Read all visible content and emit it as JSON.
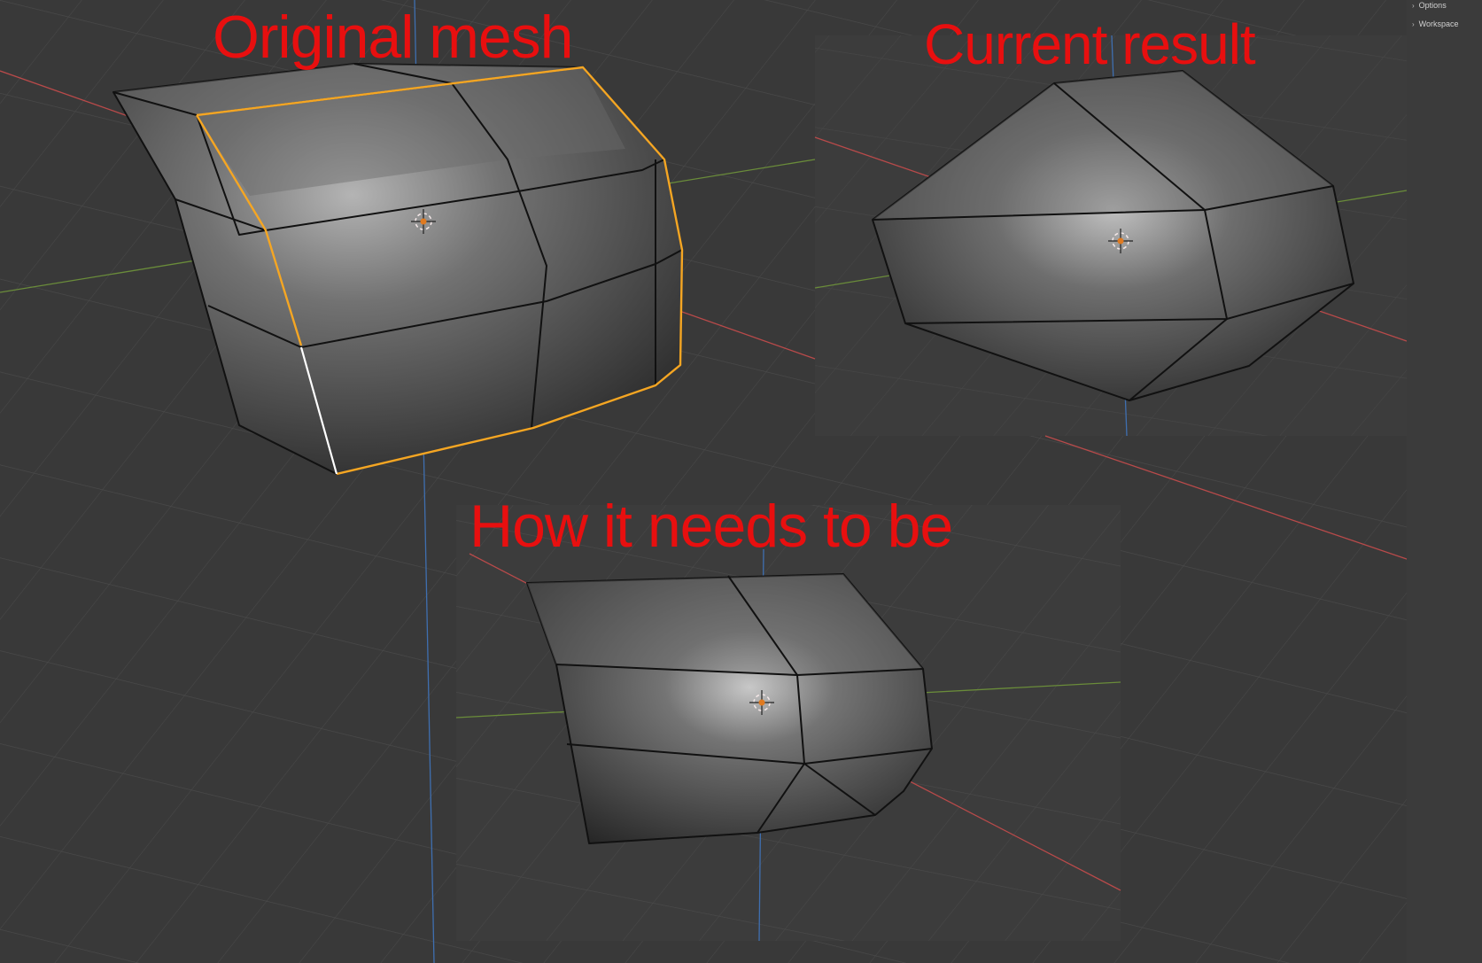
{
  "labels": {
    "original": "Original mesh",
    "current": "Current result",
    "target": "How it needs to be"
  },
  "sidebar": {
    "items": [
      {
        "label": "Options",
        "icon": "chevron-right-icon"
      },
      {
        "label": "Workspace",
        "icon": "chevron-right-icon"
      }
    ]
  },
  "colors": {
    "label_red": "#e80f0f",
    "selection_orange": "#f5a623",
    "active_edge_white": "#ffffff",
    "axis_x_red": "#b84a4a",
    "axis_y_green": "#6a8c3a",
    "axis_z_blue": "#3f6fb0",
    "viewport_bg": "#3a3a3a"
  }
}
